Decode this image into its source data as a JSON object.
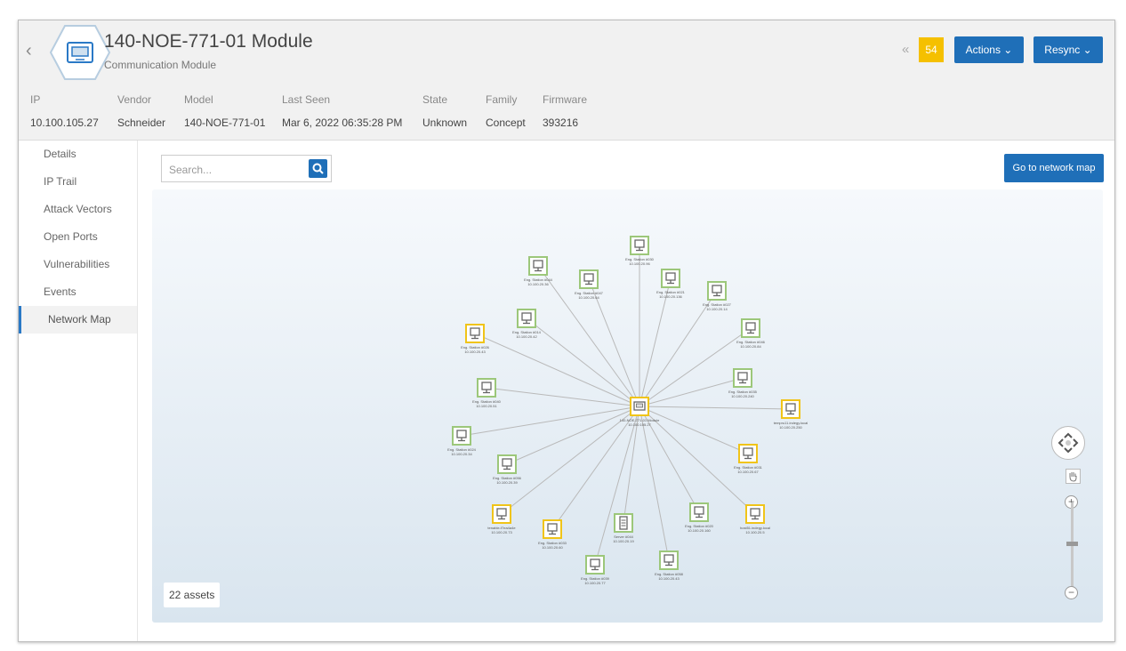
{
  "header": {
    "title": "140-NOE-771-01 Module",
    "subtitle": "Communication Module",
    "badge": "54",
    "actions_label": "Actions ⌄",
    "resync_label": "Resync ⌄",
    "fields": [
      {
        "label": "IP",
        "value": "10.100.105.27"
      },
      {
        "label": "Vendor",
        "value": "Schneider"
      },
      {
        "label": "Model",
        "value": "140-NOE-771-01"
      },
      {
        "label": "Last Seen",
        "value": "Mar 6, 2022 06:35:28 PM"
      },
      {
        "label": "State",
        "value": "Unknown"
      },
      {
        "label": "Family",
        "value": "Concept"
      },
      {
        "label": "Firmware",
        "value": "393216"
      }
    ]
  },
  "sidebar": {
    "items": [
      {
        "label": "Details"
      },
      {
        "label": "IP Trail"
      },
      {
        "label": "Attack Vectors"
      },
      {
        "label": "Open Ports"
      },
      {
        "label": "Vulnerabilities"
      },
      {
        "label": "Events"
      },
      {
        "label": "Network Map"
      }
    ],
    "active": "Network Map"
  },
  "search": {
    "placeholder": "Search..."
  },
  "go_to_map_label": "Go to network map",
  "assets_count": "22 assets",
  "colors": {
    "accent": "#1f6fb8",
    "badge": "#f5c000",
    "node_green": "#9cc77a",
    "node_yellow": "#f0c419"
  },
  "network": {
    "center": {
      "label": "140-NOE-771-01 Module",
      "ip": "10.100.105.27",
      "status": "yellow"
    },
    "nodes": [
      {
        "label": "Eng. Station #030",
        "ip": "10.100.20.96",
        "status": "green"
      },
      {
        "label": "Eng. Station #044",
        "ip": "10.100.20.36",
        "status": "green"
      },
      {
        "label": "Eng. Station #047",
        "ip": "10.100.20.64",
        "status": "green"
      },
      {
        "label": "Eng. Station #021",
        "ip": "10.100.20.136",
        "status": "green"
      },
      {
        "label": "Eng. Station #027",
        "ip": "10.100.20.14",
        "status": "green"
      },
      {
        "label": "Eng. Station #014",
        "ip": "10.100.20.42",
        "status": "green"
      },
      {
        "label": "Eng. Station #026",
        "ip": "10.100.20.43",
        "status": "yellow"
      },
      {
        "label": "Eng. Station #046",
        "ip": "10.100.20.84",
        "status": "green"
      },
      {
        "label": "Eng. Station #040",
        "ip": "10.100.20.51",
        "status": "green"
      },
      {
        "label": "Eng. Station #035",
        "ip": "10.100.20.240",
        "status": "green"
      },
      {
        "label": "tempru11.indegy.local",
        "ip": "10.100.20.250",
        "status": "yellow"
      },
      {
        "label": "Eng. Station #024",
        "ip": "10.100.20.34",
        "status": "green"
      },
      {
        "label": "Eng. Station #031",
        "ip": "10.100.20.67",
        "status": "yellow"
      },
      {
        "label": "Eng. Station #056",
        "ip": "10.100.20.39",
        "status": "green"
      },
      {
        "label": "tenable-f7ea4a4e",
        "ip": "10.100.20.73",
        "status": "yellow"
      },
      {
        "label": "Eng. Station #033",
        "ip": "10.100.20.60",
        "status": "yellow"
      },
      {
        "label": "Server #044",
        "ip": "10.100.20.19",
        "status": "green"
      },
      {
        "label": "Eng. Station #020",
        "ip": "10.100.20.160",
        "status": "green"
      },
      {
        "label": "host51.indegy.local",
        "ip": "10.100.20.5",
        "status": "yellow"
      },
      {
        "label": "Eng. Station #039",
        "ip": "10.100.20.77",
        "status": "green"
      },
      {
        "label": "Eng. Station #058",
        "ip": "10.100.20.43",
        "status": "green"
      }
    ]
  }
}
